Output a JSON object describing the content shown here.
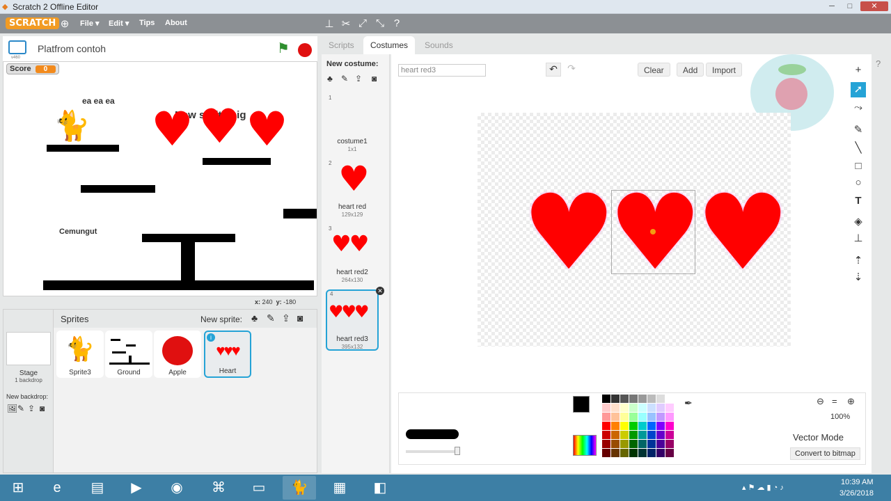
{
  "window": {
    "title": "Scratch 2 Offline Editor",
    "controls": [
      "─",
      "□",
      "✕"
    ]
  },
  "menubar": {
    "logo": "SCRATCH",
    "items": [
      "File ▾",
      "Edit ▾",
      "Tips",
      "About"
    ]
  },
  "stage": {
    "project_title": "Platfrom contoh",
    "version": "v460",
    "score_label": "Score",
    "score_value": "0",
    "text_top": "ea ea ea",
    "text_overlap": "New sprite big",
    "text_bottom": "Cemungut",
    "coords_x_label": "x:",
    "coords_x": "240",
    "coords_y_label": "y:",
    "coords_y": "-180"
  },
  "sprites": {
    "header": "Sprites",
    "new_sprite_label": "New sprite:",
    "stage_label": "Stage",
    "stage_sub": "1 backdrop",
    "new_backdrop_label": "New backdrop:",
    "items": [
      {
        "name": "Sprite3"
      },
      {
        "name": "Ground"
      },
      {
        "name": "Apple"
      },
      {
        "name": "Heart"
      }
    ]
  },
  "tabs": [
    "Scripts",
    "Costumes",
    "Sounds"
  ],
  "costumes": {
    "new_costume_label": "New costume:",
    "items": [
      {
        "num": "1",
        "name": "costume1",
        "size": "1x1"
      },
      {
        "num": "2",
        "name": "heart red",
        "size": "129x129"
      },
      {
        "num": "3",
        "name": "heart red2",
        "size": "264x130"
      },
      {
        "num": "4",
        "name": "heart red3",
        "size": "395x132"
      }
    ]
  },
  "editor": {
    "costume_name_value": "heart red3",
    "clear_label": "Clear",
    "add_label": "Add",
    "import_label": "Import",
    "zoom": "100%",
    "mode": "Vector Mode",
    "convert_label": "Convert to bitmap"
  },
  "palette": {
    "selected_color": "#000000",
    "row1": [
      "#000000",
      "#333333",
      "#555555",
      "#777777",
      "#999999",
      "#bbbbbb",
      "#dddddd",
      "#ffffff"
    ],
    "rows": [
      [
        "#ffcccc",
        "#ffe0cc",
        "#ffffcc",
        "#ccffcc",
        "#ccffff",
        "#cce0ff",
        "#e0ccff",
        "#ffccff"
      ],
      [
        "#ff9999",
        "#ffc299",
        "#ffff99",
        "#99ff99",
        "#99ffff",
        "#99c2ff",
        "#c299ff",
        "#ff99ff"
      ],
      [
        "#ff0000",
        "#ff8000",
        "#ffff00",
        "#00cc00",
        "#00cccc",
        "#0066ff",
        "#8000ff",
        "#ff00cc"
      ],
      [
        "#cc0000",
        "#cc6600",
        "#cccc00",
        "#009900",
        "#009999",
        "#0044cc",
        "#6600cc",
        "#cc0099"
      ],
      [
        "#990000",
        "#994c00",
        "#999900",
        "#006600",
        "#006666",
        "#003399",
        "#4c0099",
        "#990066"
      ],
      [
        "#660000",
        "#663300",
        "#666600",
        "#003300",
        "#003333",
        "#002266",
        "#330066",
        "#660044"
      ]
    ]
  },
  "taskbar": {
    "time": "10:39 AM",
    "date": "3/26/2018"
  },
  "colors": {
    "heart": "#ff0000",
    "accent": "#25a3d6",
    "menubar": "#8c9094",
    "taskbar": "#3d7fa5"
  }
}
